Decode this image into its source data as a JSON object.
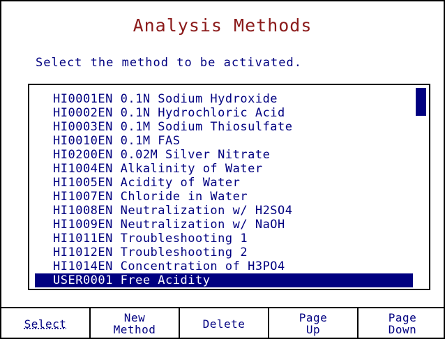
{
  "title": "Analysis Methods",
  "prompt": "Select the method to be activated.",
  "methods": [
    {
      "label": "HI0001EN 0.1N Sodium Hydroxide"
    },
    {
      "label": "HI0002EN 0.1N Hydrochloric Acid"
    },
    {
      "label": "HI0003EN 0.1M Sodium Thiosulfate"
    },
    {
      "label": "HI0010EN 0.1M FAS"
    },
    {
      "label": "HI0200EN 0.02M Silver Nitrate"
    },
    {
      "label": "HI1004EN Alkalinity of Water"
    },
    {
      "label": "HI1005EN Acidity of Water"
    },
    {
      "label": "HI1007EN Chloride in Water"
    },
    {
      "label": "HI1008EN Neutralization w/ H2SO4"
    },
    {
      "label": "HI1009EN Neutralization w/ NaOH"
    },
    {
      "label": "HI1011EN Troubleshooting 1"
    },
    {
      "label": "HI1012EN Troubleshooting 2"
    },
    {
      "label": "HI1014EN Concentration of H3PO4"
    },
    {
      "label": "USER0001 Free Acidity"
    }
  ],
  "selected_index": 13,
  "softkeys": {
    "select": {
      "line1": "Select"
    },
    "new_method": {
      "line1": "New",
      "line2": "Method"
    },
    "delete": {
      "line1": "Delete"
    },
    "page_up": {
      "line1": "Page",
      "line2": "Up"
    },
    "page_down": {
      "line1": "Page",
      "line2": "Down"
    }
  },
  "colors": {
    "title": "#8b1a1a",
    "text": "#000080",
    "selection": "#000080",
    "background": "#ffffff"
  }
}
